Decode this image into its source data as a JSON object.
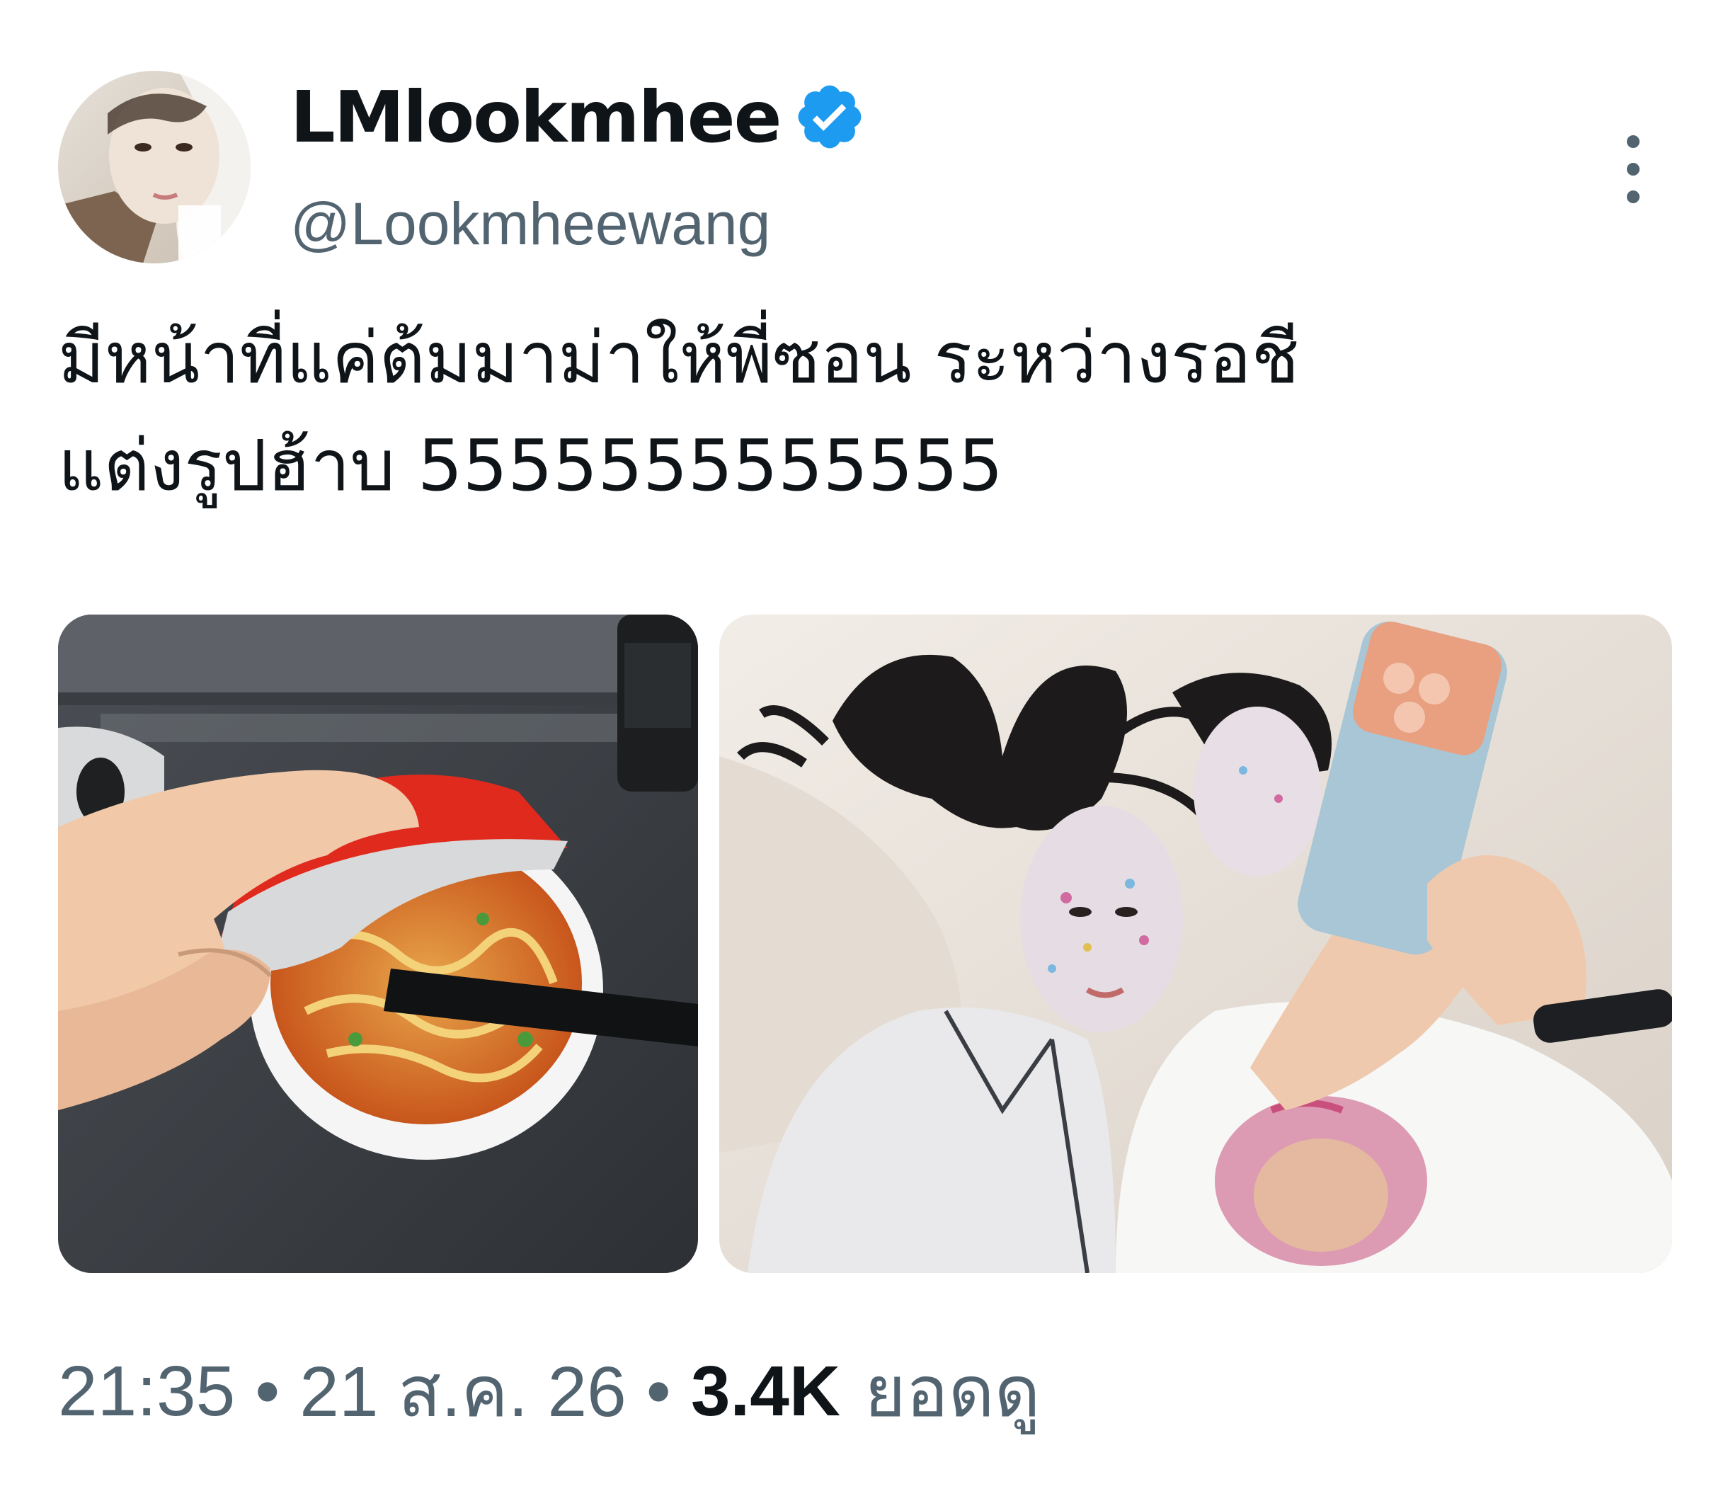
{
  "tweet": {
    "author": {
      "display_name": "LMlookmhee",
      "handle": "@Lookmheewang",
      "verified": true,
      "avatar_icon": "avatar-photo"
    },
    "more_icon": "more-vertical-icon",
    "text_line_1": "มีหน้าที่แค่ต้มมาม่าให้พี่ซอน ระหว่างรอชี",
    "text_line_2": "แต่งรูปฮ้าบ 5555555555555",
    "media": [
      {
        "icon": "photo-instant-noodle-cup"
      },
      {
        "icon": "photo-face-masks-selfie"
      }
    ],
    "meta": {
      "time": "21:35",
      "separator": "•",
      "date": "21 ส.ค. 26",
      "views_count": "3.4K",
      "views_label": "ยอดดู"
    }
  },
  "colors": {
    "text_primary": "#0f1419",
    "text_secondary": "#536471",
    "verified_blue": "#1d9bf0",
    "background": "#ffffff"
  }
}
